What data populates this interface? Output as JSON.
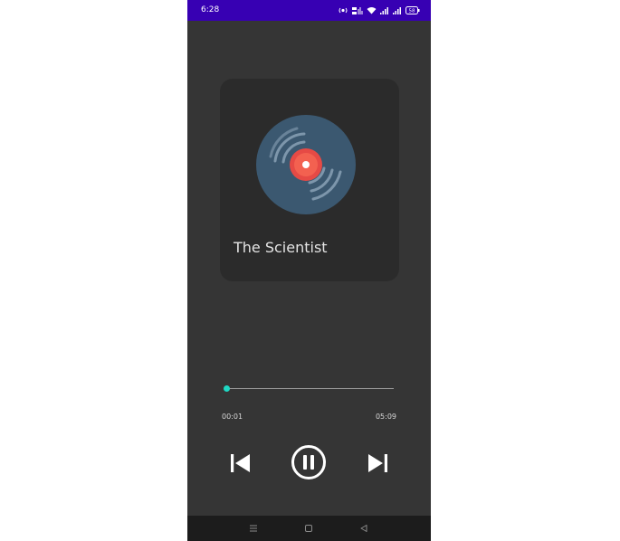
{
  "status_bar": {
    "time": "6:28",
    "battery_level": "58",
    "background_color": "#3700b3"
  },
  "player": {
    "album_art_icon": "vinyl-record-icon",
    "song_title": "The Scientist",
    "current_time": "00:01",
    "total_time": "05:09",
    "progress_fraction": 0.003,
    "accent_color": "#1fd8c4",
    "playing": true
  },
  "controls": {
    "previous_icon": "skip-previous-icon",
    "play_pause_icon": "pause-circle-icon",
    "next_icon": "skip-next-icon"
  },
  "nav_bar": {
    "menu_icon": "menu-icon",
    "home_icon": "home-square-icon",
    "back_icon": "back-triangle-icon"
  }
}
